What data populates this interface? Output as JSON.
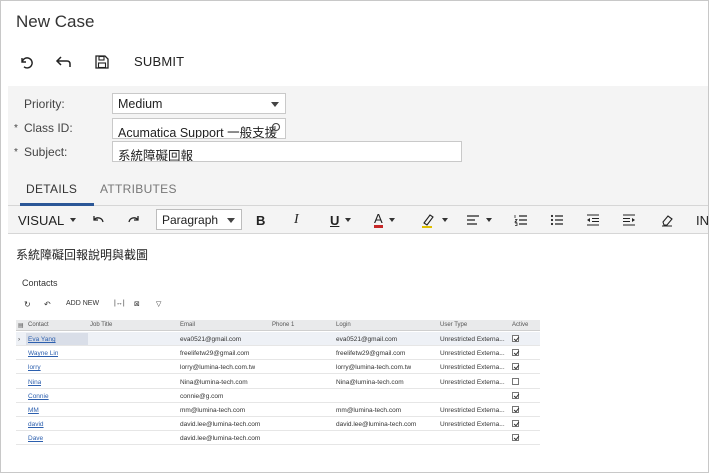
{
  "page": {
    "title": "New Case"
  },
  "toolbar": {
    "submit_label": "SUBMIT"
  },
  "form": {
    "priority_label": "Priority:",
    "priority_value": "Medium",
    "class_label": "Class ID:",
    "class_value": "Acumatica Support 一般支援",
    "subject_label": "Subject:",
    "subject_value": "系統障礙回報",
    "required_mark": "*"
  },
  "tabs": [
    {
      "label": "DETAILS",
      "active": true
    },
    {
      "label": "ATTRIBUTES",
      "active": false
    }
  ],
  "editor": {
    "mode_label": "VISUAL",
    "paragraph_label": "Paragraph",
    "bold": "B",
    "italic": "I",
    "underline": "U",
    "font_color": "A",
    "more": "IN",
    "body_text": "系統障礙回報說明與截圖"
  },
  "embedded": {
    "title": "Contacts",
    "add_new_label": "ADD NEW",
    "columns": [
      "Contact",
      "Job Title",
      "Email",
      "Phone 1",
      "Login",
      "User Type",
      "Active"
    ],
    "rows": [
      {
        "contact": "Eva Yang",
        "email": "eva0521@gmail.com",
        "login": "eva0521@gmail.com",
        "user_type": "Unrestricted Externa...",
        "active": true
      },
      {
        "contact": "Wayne Lin",
        "email": "freelifetw29@gmail.com",
        "login": "freelifetw29@gmail.com",
        "user_type": "Unrestricted Externa...",
        "active": true
      },
      {
        "contact": "lorry",
        "email": "lorry@lumina-tech.com.tw",
        "login": "lorry@lumina-tech.com.tw",
        "user_type": "Unrestricted Externa...",
        "active": true
      },
      {
        "contact": "Nina",
        "email": "Nina@lumina-tech.com",
        "login": "Nina@lumina-tech.com",
        "user_type": "Unrestricted Externa...",
        "active": false
      },
      {
        "contact": "Connie",
        "email": "connie@g.com",
        "login": "",
        "user_type": "",
        "active": true
      },
      {
        "contact": "MM",
        "email": "mm@lumina-tech.com",
        "login": "mm@lumina-tech.com",
        "user_type": "Unrestricted Externa...",
        "active": true
      },
      {
        "contact": "david",
        "email": "david.lee@lumina-tech.com",
        "login": "david.lee@lumina-tech.com",
        "user_type": "Unrestricted Externa...",
        "active": true
      },
      {
        "contact": "Dave",
        "email": "david.lee@lumina-tech.com",
        "login": "",
        "user_type": "",
        "active": true
      }
    ]
  },
  "icons": {
    "undo": "undo-icon",
    "back": "back-arrow-icon",
    "save": "save-icon"
  }
}
